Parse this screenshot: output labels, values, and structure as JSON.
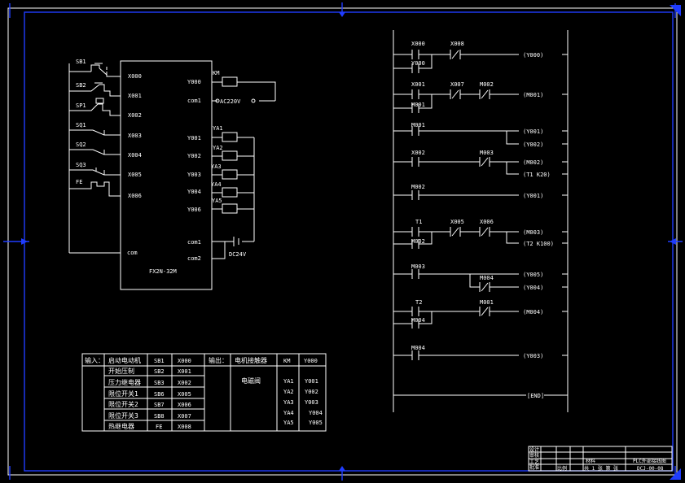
{
  "plc": {
    "model": "FX2N-32M",
    "inputs": [
      {
        "device": "SB1",
        "term": "X000"
      },
      {
        "device": "SB2",
        "term": "X001"
      },
      {
        "device": "SP1",
        "term": "X002"
      },
      {
        "device": "SQ1",
        "term": "X003"
      },
      {
        "device": "SQ2",
        "term": "X004"
      },
      {
        "device": "SQ3",
        "term": "X005"
      },
      {
        "device": "FE",
        "term": "X006"
      }
    ],
    "com_left": "com",
    "outputs_top": [
      {
        "term": "Y000"
      },
      {
        "term": "com1"
      }
    ],
    "km_label": "KM",
    "supply_ac": "AC220V",
    "valves": [
      {
        "label": "YA1",
        "term": "Y001"
      },
      {
        "label": "YA2",
        "term": "Y002"
      },
      {
        "label": "YA3",
        "term": "Y003"
      },
      {
        "label": "YA4",
        "term": "Y004"
      },
      {
        "label": "YA5",
        "term": "Y006"
      }
    ],
    "com_right": [
      "com1",
      "com2"
    ],
    "supply_dc": "DC24V"
  },
  "io_table": {
    "in_header": "输入：",
    "out_header": "输出：",
    "in_rows": [
      [
        "启动电动机",
        "SB1",
        "X000"
      ],
      [
        "开始压制",
        "SB2",
        "X001"
      ],
      [
        "压力继电器",
        "SB3",
        "X002"
      ],
      [
        "限位开关1",
        "SB6",
        "X005"
      ],
      [
        "限位开关2",
        "SB7",
        "X006"
      ],
      [
        "限位开关3",
        "SB8",
        "X007"
      ],
      [
        "热继电器",
        "FE",
        "X008"
      ]
    ],
    "out_motor": [
      "电机接触器",
      "KM",
      "Y000"
    ],
    "out_valve_name": "电磁阀",
    "out_valves": [
      [
        "YA1",
        "Y001"
      ],
      [
        "YA2",
        "Y002"
      ],
      [
        "YA3",
        "Y003"
      ],
      [
        "YA4",
        "Y004"
      ],
      [
        "YA5",
        "Y005"
      ]
    ]
  },
  "ladder": {
    "rungs": [
      {
        "contacts": [
          "X000",
          "X008"
        ],
        "branch": "Y000",
        "coil": "(Y000)"
      },
      {
        "contacts": [
          "X001",
          "X007",
          "M002"
        ],
        "branch": "M001",
        "coil": "(M001)"
      },
      {
        "contacts": [
          "M001"
        ],
        "coils": [
          "(Y001)",
          "(Y002)"
        ]
      },
      {
        "contacts": [
          "X002",
          "M003"
        ],
        "coils": [
          "(M002)",
          "(T1  K20)"
        ]
      },
      {
        "contacts": [
          "M002"
        ],
        "coil": "(Y001)"
      },
      {
        "contacts": [
          "T1",
          "X005",
          "X006"
        ],
        "branch": "M002",
        "coils": [
          "(M003)",
          "(T2  K100)"
        ]
      },
      {
        "contacts": [
          "M003",
          "M004"
        ],
        "coils": [
          "(Y005)",
          "(Y004)"
        ]
      },
      {
        "contacts": [
          "T2",
          "M001"
        ],
        "branch": "M004",
        "coil": "(M004)"
      },
      {
        "contacts": [
          "M004"
        ],
        "coil": "(Y003)"
      }
    ],
    "end": "[END]"
  },
  "title_block": {
    "labels": [
      "设计",
      "审核",
      "工艺",
      "批准"
    ],
    "drawing_title": "PLC外部接线图",
    "material": "材料",
    "code": "DCJ-00-08",
    "sheet": "共  1  张  第    张",
    "scale_label": "比例"
  }
}
